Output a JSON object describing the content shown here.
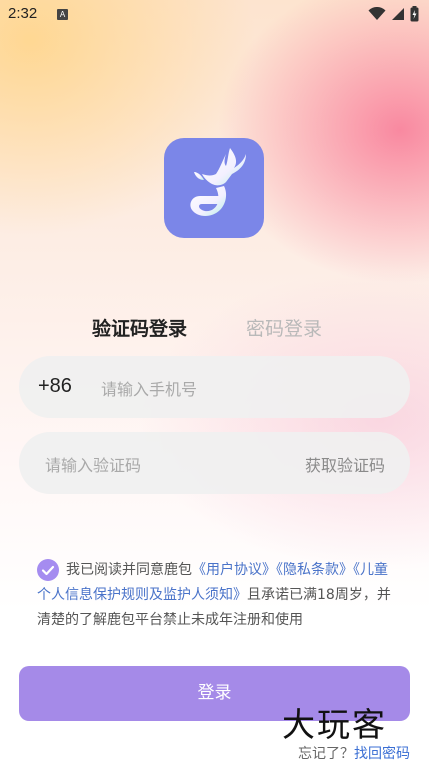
{
  "status_bar": {
    "time": "2:32",
    "badge": "A"
  },
  "logo": {
    "icon": "deer-logo-icon",
    "background_color": "#7b86e8"
  },
  "tabs": [
    {
      "label": "验证码登录",
      "active": true
    },
    {
      "label": "密码登录",
      "active": false
    }
  ],
  "phone": {
    "country_code": "+86",
    "placeholder": "请输入手机号"
  },
  "code": {
    "placeholder": "请输入验证码",
    "get_code_label": "获取验证码"
  },
  "agreement": {
    "checked": true,
    "text_1": "我已阅读并同意鹿包",
    "link_user": "《用户协议》",
    "link_privacy": "《隐私条款》",
    "link_child": "《儿童个人信息保护规则及监护人须知》",
    "text_2": "且承诺已满18周岁，并清楚的了解鹿包平台禁止未成年注册和使用"
  },
  "login_button": "登录",
  "watermark": "大玩客",
  "forgot": {
    "prompt": "忘记了？",
    "link": "找回密码"
  },
  "colors": {
    "accent": "#a58ae8",
    "link": "#4a73c9"
  }
}
